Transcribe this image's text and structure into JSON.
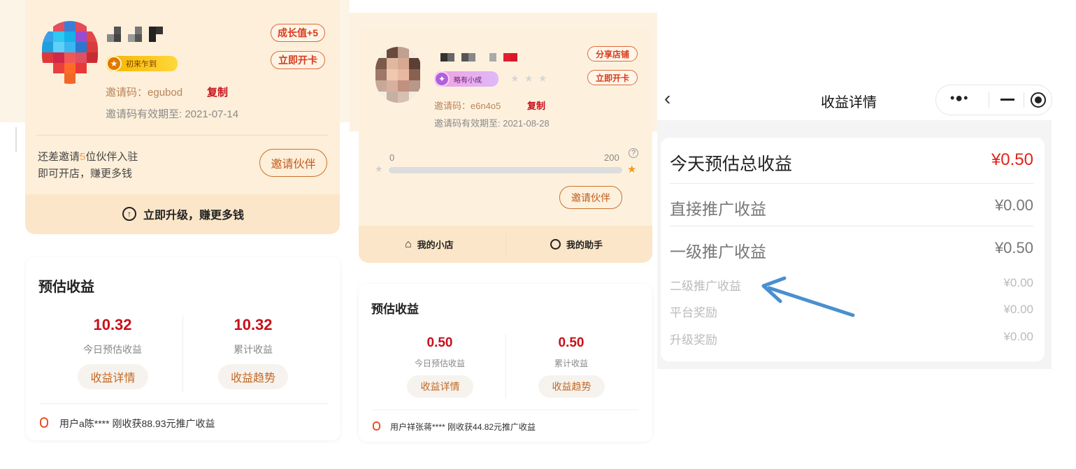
{
  "panel1": {
    "growth_btn": "成长值+5",
    "open_card_btn": "立即开卡",
    "level_badge": "初来乍到",
    "invite_code_label": "邀请码：",
    "invite_code": "egubod",
    "copy_label": "复制",
    "validity": "邀请码有效期至: 2021-07-14",
    "invite_line1_pre": "还差邀请",
    "invite_count": "5",
    "invite_line1_post": "位伙伴入驻",
    "invite_line2": "即可开店，赚更多钱",
    "invite_partner_btn": "邀请伙伴",
    "upgrade_text": "立即升级，赚更多钱",
    "earnings": {
      "title": "预估收益",
      "today_value": "10.32",
      "today_label": "今日预估收益",
      "total_value": "10.32",
      "total_label": "累计收益",
      "detail_btn": "收益详情",
      "trend_btn": "收益趋势",
      "ticker": "用户a陈**** 刚收获88.93元推广收益"
    }
  },
  "panel2": {
    "share_shop_btn": "分享店铺",
    "open_card_btn": "立即开卡",
    "level_badge": "略有小成",
    "invite_code_label": "邀请码：",
    "invite_code": "e6n4o5",
    "copy_label": "复制",
    "validity": "邀请码有效期至: 2021-08-28",
    "progress_min": "0",
    "progress_max": "200",
    "progress_fraction": 0.0,
    "invite_partner_btn": "邀请伙伴",
    "my_shop": "我的小店",
    "my_assistant": "我的助手",
    "earnings": {
      "title": "预估收益",
      "today_value": "0.50",
      "today_label": "今日预估收益",
      "total_value": "0.50",
      "total_label": "累计收益",
      "detail_btn": "收益详情",
      "trend_btn": "收益趋势",
      "ticker": "用户祥张蒋**** 刚收获44.82元推广收益"
    }
  },
  "panel3": {
    "title": "收益详情",
    "back_icon": "chevron-left-icon",
    "rows": [
      {
        "label": "今天预估总收益",
        "value": "¥0.50"
      },
      {
        "label": "直接推广收益",
        "value": "¥0.00"
      },
      {
        "label": "一级推广收益",
        "value": "¥0.50"
      },
      {
        "label": "二级推广收益",
        "value": "¥0.00"
      },
      {
        "label": "平台奖励",
        "value": "¥0.00"
      },
      {
        "label": "升级奖励",
        "value": "¥0.00"
      }
    ]
  },
  "colors": {
    "accent_red": "#c8101b",
    "accent_orange": "#c4671f",
    "card_cream": "#fdefd9",
    "annotation_arrow": "#4a90d0"
  }
}
